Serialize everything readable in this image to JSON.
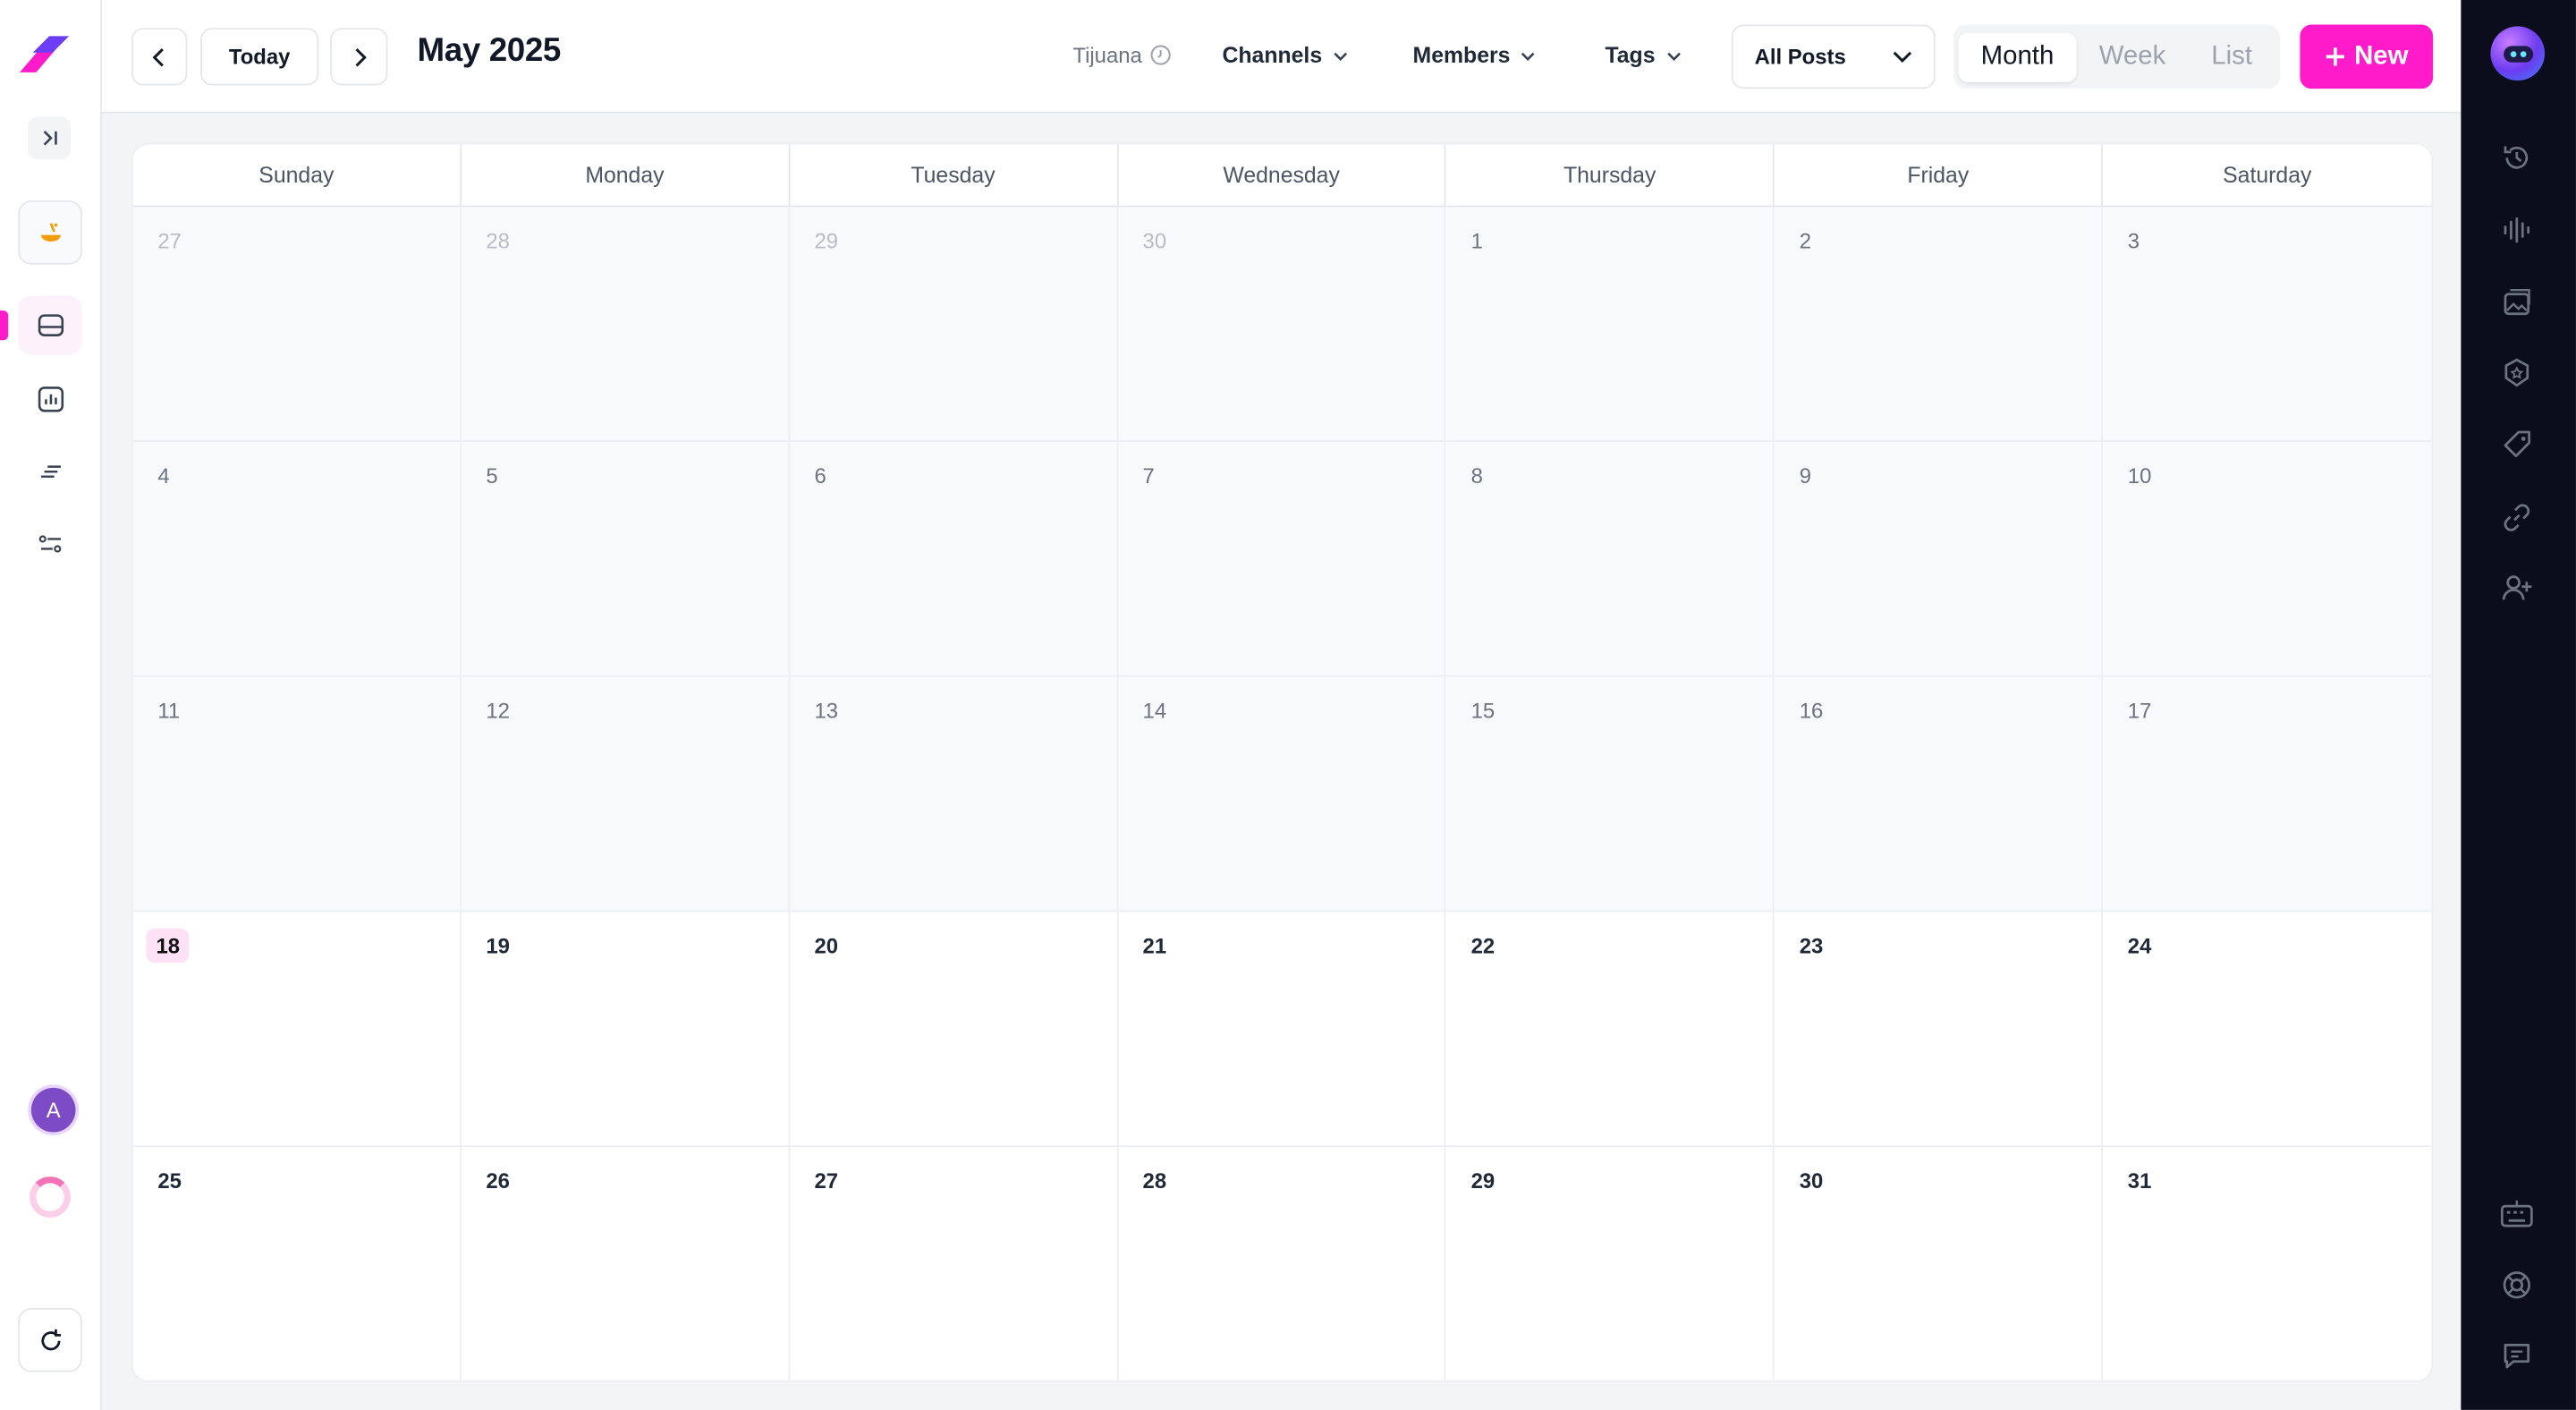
{
  "toolbar": {
    "today_label": "Today",
    "month_title": "May 2025",
    "timezone": "Tijuana",
    "filters": [
      "Channels",
      "Members",
      "Tags"
    ],
    "post_filter": "All Posts",
    "views": [
      "Month",
      "Week",
      "List"
    ],
    "active_view": "Month",
    "new_label": "New"
  },
  "sidebar": {
    "avatar_initial": "A",
    "items": [
      "ai-assistant",
      "calendar",
      "analytics",
      "feed",
      "settings"
    ]
  },
  "calendar": {
    "weekdays": [
      "Sunday",
      "Monday",
      "Tuesday",
      "Wednesday",
      "Thursday",
      "Friday",
      "Saturday"
    ],
    "days": [
      "27",
      "28",
      "29",
      "30",
      "1",
      "2",
      "3",
      "4",
      "5",
      "6",
      "7",
      "8",
      "9",
      "10",
      "11",
      "12",
      "13",
      "14",
      "15",
      "16",
      "17",
      "18",
      "19",
      "20",
      "21",
      "22",
      "23",
      "24",
      "25",
      "26",
      "27",
      "28",
      "29",
      "30",
      "31"
    ],
    "today": "18"
  },
  "right_sidebar": {
    "icons": [
      "history-icon",
      "audio-icon",
      "images-icon",
      "badge-icon",
      "tag-icon",
      "link-icon",
      "add-user-icon",
      "keyboard-icon",
      "help-icon",
      "chat-icon"
    ]
  },
  "colors": {
    "accent": "#ff1aca",
    "right_bar": "#0b0c1c"
  }
}
